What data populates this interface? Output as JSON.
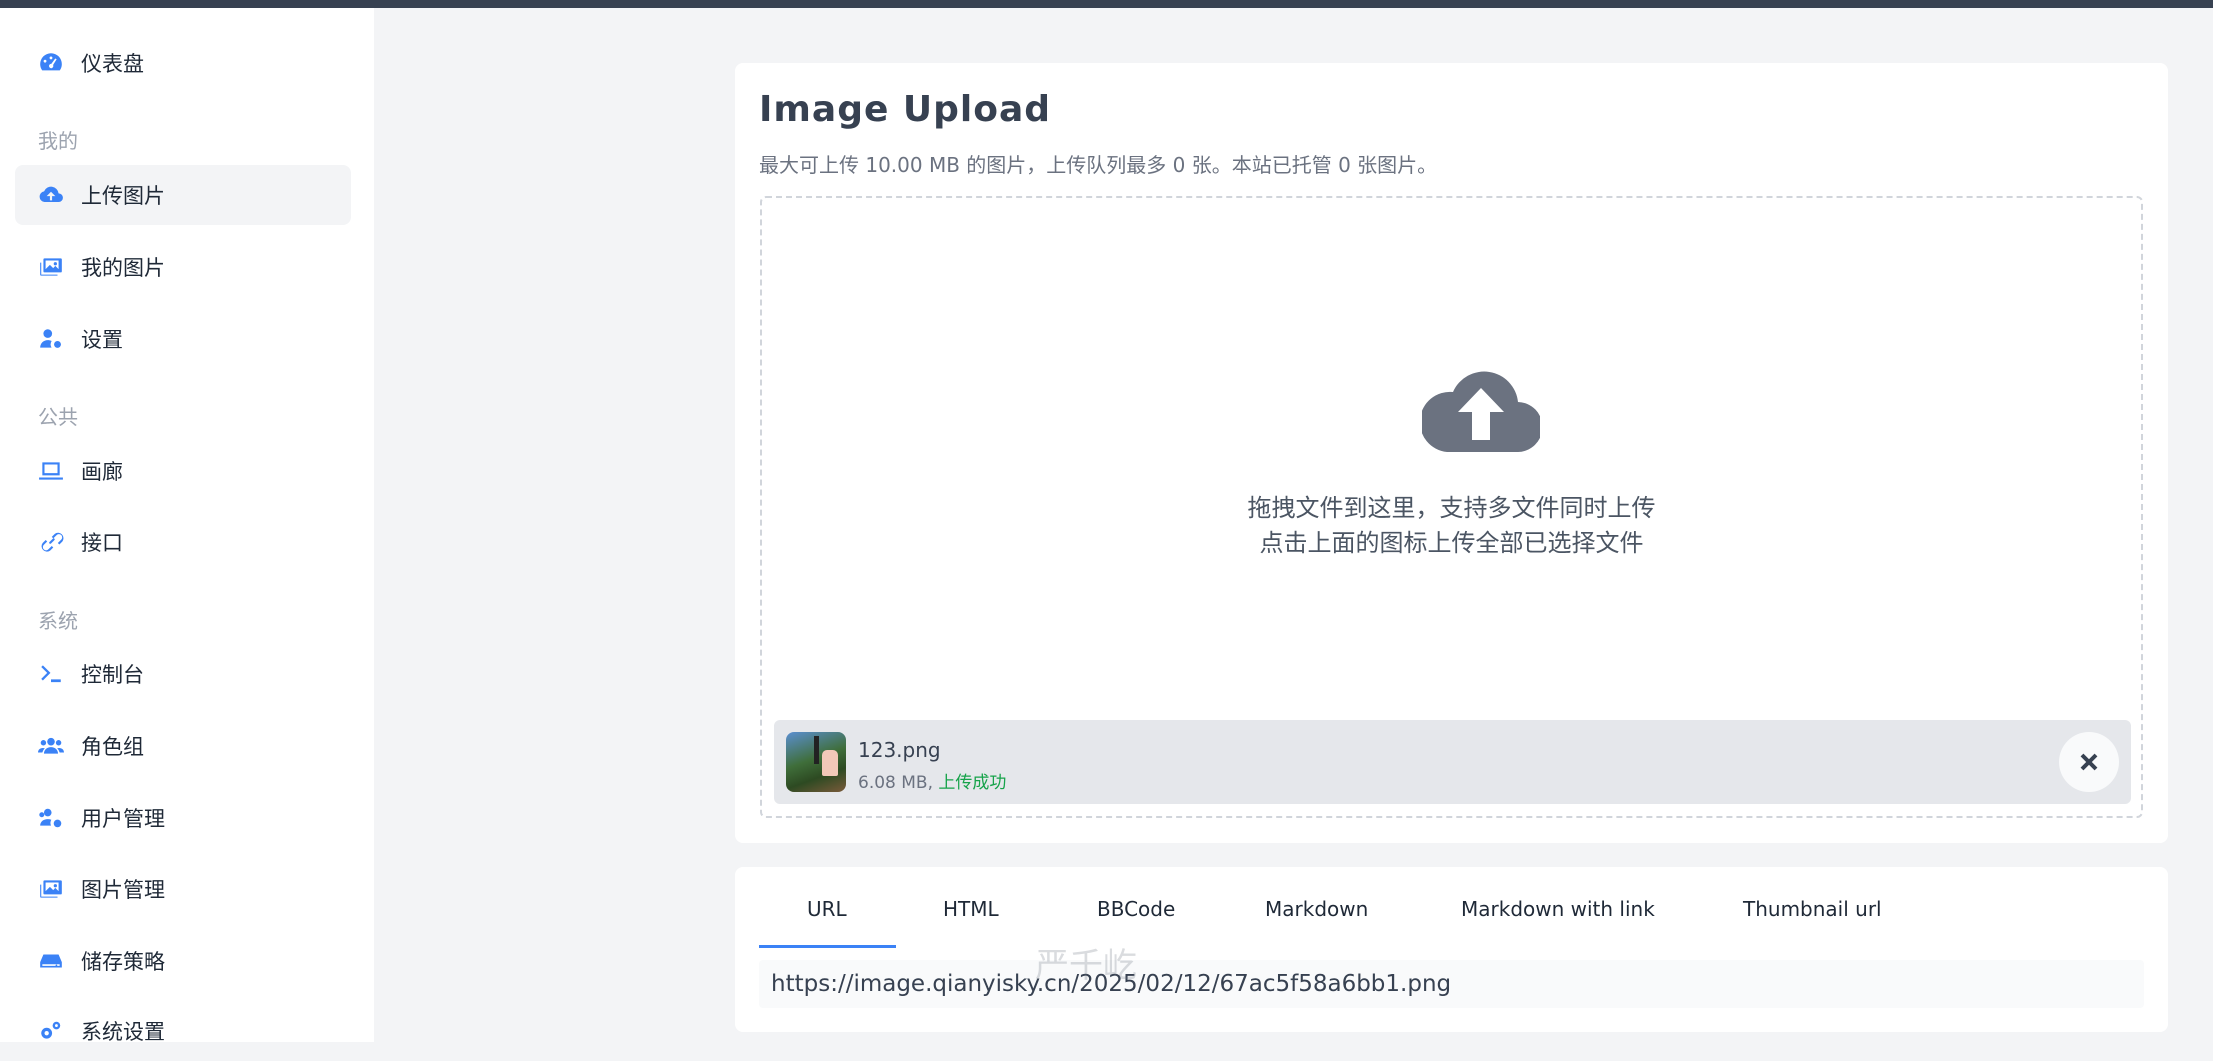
{
  "sidebar": {
    "dashboard": {
      "label": "仪表盘",
      "icon": "speedometer-icon"
    },
    "section_mine": "我的",
    "upload": {
      "label": "上传图片",
      "icon": "cloud-upload-icon"
    },
    "my_images": {
      "label": "我的图片",
      "icon": "images-icon"
    },
    "settings": {
      "label": "设置",
      "icon": "user-cog-icon"
    },
    "section_public": "公共",
    "gallery": {
      "label": "画廊",
      "icon": "laptop-icon"
    },
    "api": {
      "label": "接口",
      "icon": "link-icon"
    },
    "section_system": "系统",
    "console": {
      "label": "控制台",
      "icon": "terminal-icon"
    },
    "roles": {
      "label": "角色组",
      "icon": "users-icon"
    },
    "user_mgmt": {
      "label": "用户管理",
      "icon": "users-cog-icon"
    },
    "image_mgmt": {
      "label": "图片管理",
      "icon": "images-icon"
    },
    "storage": {
      "label": "储存策略",
      "icon": "hdd-icon"
    },
    "system_settings": {
      "label": "系统设置",
      "icon": "cogs-icon"
    }
  },
  "upload": {
    "title": "Image Upload",
    "subtitle": "最大可上传 10.00 MB 的图片，上传队列最多 0 张。本站已托管 0 张图片。",
    "drop_line1": "拖拽文件到这里，支持多文件同时上传",
    "drop_line2": "点击上面的图标上传全部已选择文件",
    "file": {
      "name": "123.png",
      "size": "6.08 MB,",
      "status": "上传成功"
    }
  },
  "links": {
    "tabs": [
      "URL",
      "HTML",
      "BBCode",
      "Markdown",
      "Markdown with link",
      "Thumbnail url"
    ],
    "active_tab": "URL",
    "value": "https://image.qianyisky.cn/2025/02/12/67ac5f58a6bb1.png"
  },
  "watermark": "严千屹",
  "colors": {
    "accent": "#3b82f6",
    "success": "#16a34a",
    "topbar": "#374151"
  }
}
